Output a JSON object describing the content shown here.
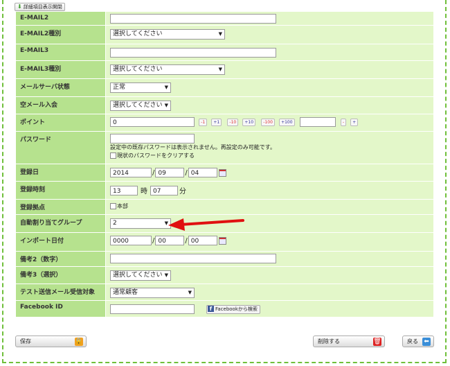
{
  "toggle_label": "詳細項目表示開閉",
  "fields": {
    "email2": {
      "label": "E-MAIL2",
      "value": ""
    },
    "email2_type": {
      "label": "E-MAIL2種別",
      "value": "選択してください"
    },
    "email3": {
      "label": "E-MAIL3",
      "value": ""
    },
    "email3_type": {
      "label": "E-MAIL3種別",
      "value": "選択してください"
    },
    "mail_server": {
      "label": "メールサーバ状態",
      "value": "正常"
    },
    "empty_mail": {
      "label": "空メール入会",
      "value": "選択してください"
    },
    "points": {
      "label": "ポイント",
      "value": "0",
      "extra": "",
      "buttons": [
        "-1",
        "+1",
        "-10",
        "+10",
        "-100",
        "+100"
      ],
      "minus": "-",
      "plus": "+"
    },
    "password": {
      "label": "パスワード",
      "value": "",
      "note": "設定中の既存パスワードは表示されません。再設定のみ可能です。",
      "clear_label": "現状のパスワードをクリアする"
    },
    "reg_date": {
      "label": "登録日",
      "year": "2014",
      "month": "09",
      "day": "04",
      "sep": "/"
    },
    "reg_time": {
      "label": "登録時刻",
      "hour": "13",
      "hour_unit": "時",
      "minute": "07",
      "minute_unit": "分"
    },
    "reg_base": {
      "label": "登録拠点",
      "option": "本部"
    },
    "auto_group": {
      "label": "自動割り当てグループ",
      "value": "2"
    },
    "import_date": {
      "label": "インポート日付",
      "year": "0000",
      "month": "00",
      "day": "00",
      "sep": "/"
    },
    "note2": {
      "label": "備考2（数字）",
      "value": ""
    },
    "note3": {
      "label": "備考3（選択）",
      "value": "選択してください"
    },
    "test_mail": {
      "label": "テスト送信メール受信対象",
      "value": "通常顧客"
    },
    "facebook": {
      "label": "Facebook ID",
      "value": "",
      "search_label": "Facebookから検索"
    }
  },
  "footer": {
    "save": "保存",
    "delete": "削除する",
    "back": "戻る"
  },
  "colors": {
    "label_bg": "#b6e28e",
    "value_bg": "#e3f7c9",
    "frame": "#6fbf3a",
    "arrow": "#e01010"
  }
}
